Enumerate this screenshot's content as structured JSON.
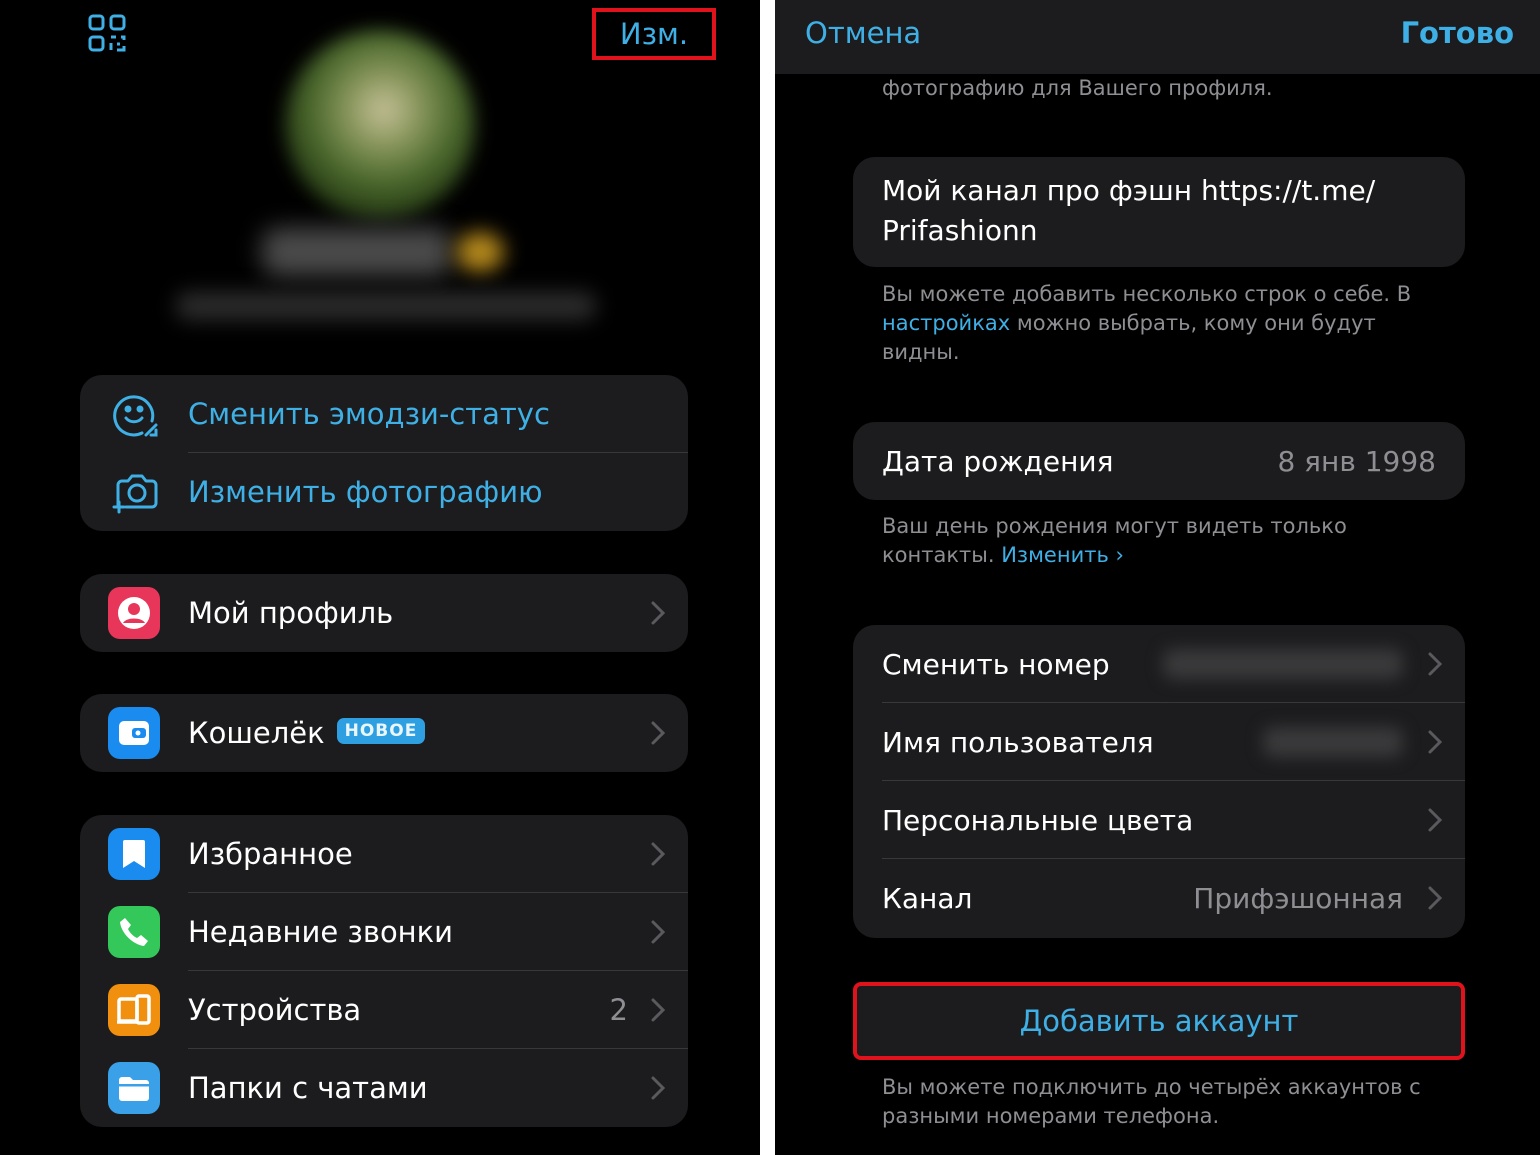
{
  "left": {
    "edit_label": "Изм.",
    "actions": [
      {
        "label": "Сменить эмодзи-статус",
        "icon": "emoji-status-icon"
      },
      {
        "label": "Изменить фотографию",
        "icon": "camera-icon"
      }
    ],
    "profile": {
      "label": "Мой профиль",
      "icon": "profile-icon",
      "color": "#e8365a"
    },
    "wallet": {
      "label": "Кошелёк",
      "badge": "НОВОЕ",
      "icon": "wallet-icon",
      "color": "#1a8cf0"
    },
    "menu": [
      {
        "label": "Избранное",
        "icon": "bookmark-icon",
        "color": "#1a8cf0",
        "count": ""
      },
      {
        "label": "Недавние звонки",
        "icon": "phone-icon",
        "color": "#34c759",
        "count": ""
      },
      {
        "label": "Устройства",
        "icon": "devices-icon",
        "color": "#f0900e",
        "count": "2"
      },
      {
        "label": "Папки с чатами",
        "icon": "folder-icon",
        "color": "#3aa0e8",
        "count": ""
      }
    ]
  },
  "right": {
    "cancel_label": "Отмена",
    "done_label": "Готово",
    "photo_hint": "фотографию для Вашего профиля.",
    "bio_text": "Мой канал про фэшн https://t.me/ Prifashionn",
    "bio_hint_before": "Вы можете добавить несколько строк о себе. В ",
    "bio_hint_link": "настройках",
    "bio_hint_after": " можно выбрать, кому они будут видны.",
    "birthday": {
      "label": "Дата рождения",
      "value": "8 янв 1998"
    },
    "birthday_hint": "Ваш день рождения могут видеть только контакты. ",
    "birthday_hint_link": "Изменить ›",
    "rows": [
      {
        "label": "Сменить номер",
        "value": ""
      },
      {
        "label": "Имя пользователя",
        "value": ""
      },
      {
        "label": "Персональные цвета",
        "value": ""
      },
      {
        "label": "Канал",
        "value": "Прифэшонная"
      }
    ],
    "add_account_label": "Добавить аккаунт",
    "add_account_hint": "Вы можете подключить до четырёх аккаунтов с разными номерами телефона."
  },
  "colors": {
    "accent": "#3fb0e6",
    "highlight": "#e0121b",
    "cell": "#1c1c1e",
    "background": "#000000"
  }
}
